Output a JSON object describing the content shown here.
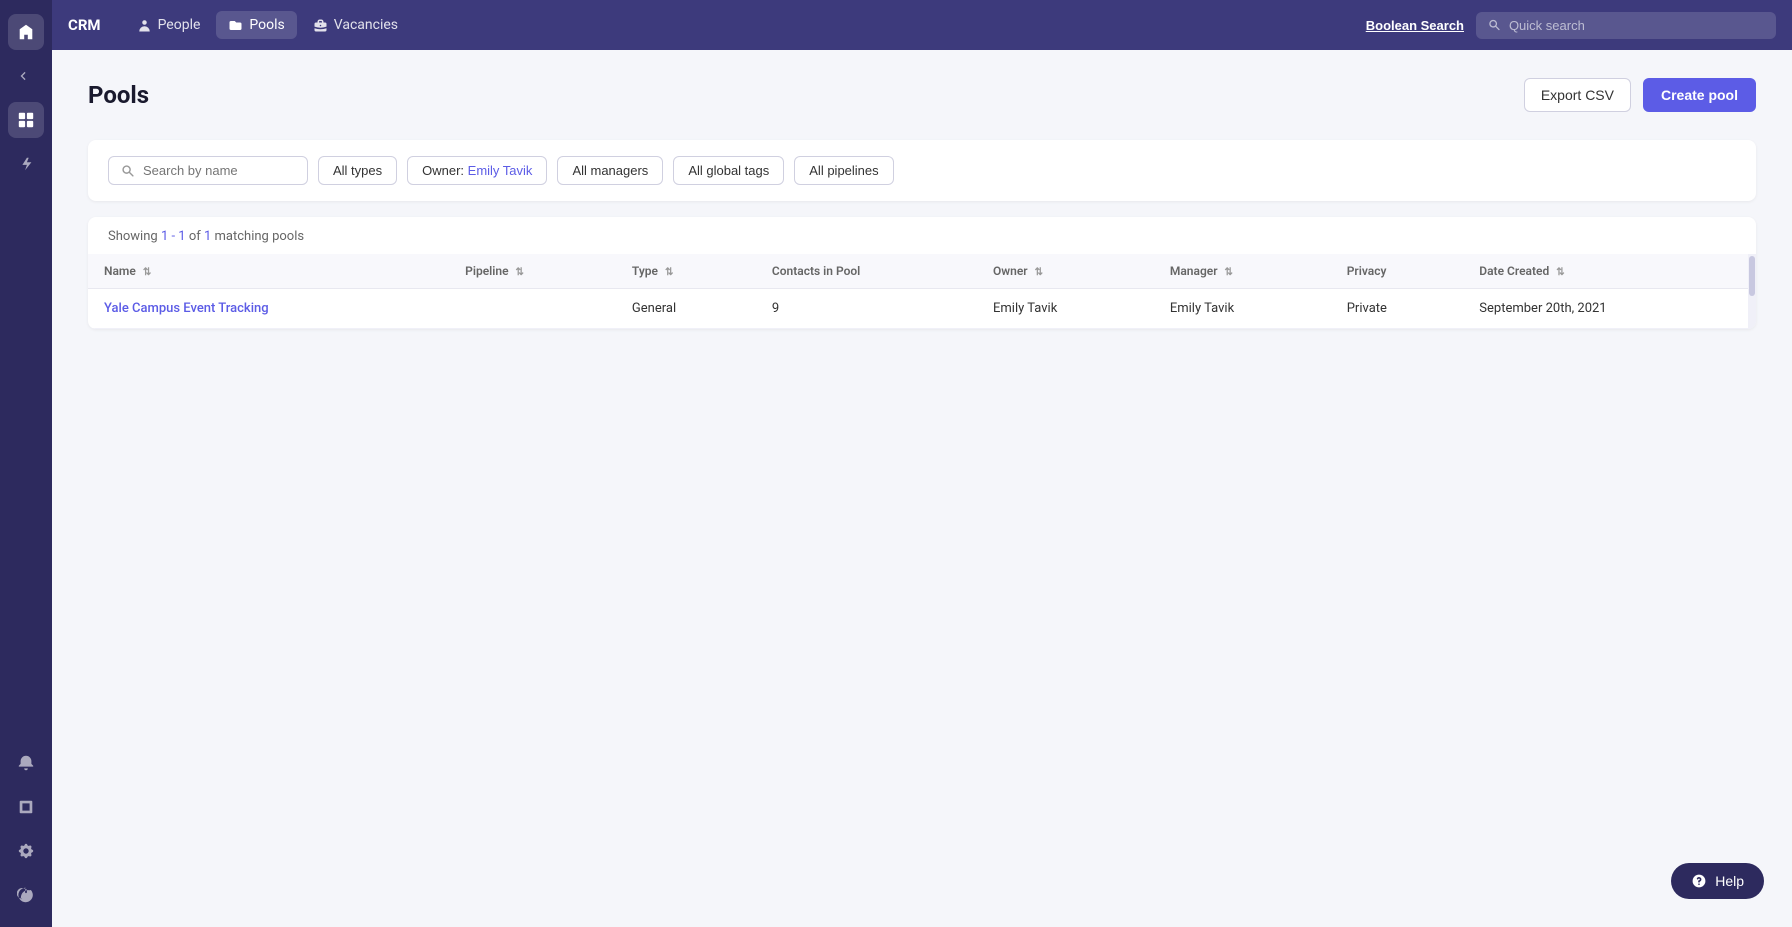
{
  "brand": "CRM",
  "topnav": {
    "items": [
      {
        "id": "people",
        "label": "People",
        "icon": "person"
      },
      {
        "id": "pools",
        "label": "Pools",
        "icon": "folder",
        "active": true
      },
      {
        "id": "vacancies",
        "label": "Vacancies",
        "icon": "briefcase"
      }
    ],
    "boolean_search_label": "Boolean Search",
    "quick_search_placeholder": "Quick search"
  },
  "page": {
    "title": "Pools",
    "export_label": "Export CSV",
    "create_label": "Create pool"
  },
  "filters": {
    "search_placeholder": "Search by name",
    "all_types_label": "All types",
    "owner_label": "Owner: Emily Tavik",
    "all_managers_label": "All managers",
    "all_global_tags_label": "All global tags",
    "all_pipelines_label": "All pipelines"
  },
  "results": {
    "summary": "Showing 1 - 1 of 1 matching pools"
  },
  "table": {
    "columns": [
      {
        "id": "name",
        "label": "Name"
      },
      {
        "id": "pipeline",
        "label": "Pipeline"
      },
      {
        "id": "type",
        "label": "Type"
      },
      {
        "id": "contacts",
        "label": "Contacts in Pool"
      },
      {
        "id": "owner",
        "label": "Owner"
      },
      {
        "id": "manager",
        "label": "Manager"
      },
      {
        "id": "privacy",
        "label": "Privacy"
      },
      {
        "id": "date_created",
        "label": "Date Created"
      }
    ],
    "rows": [
      {
        "name": "Yale Campus Event Tracking",
        "pipeline": "",
        "type": "General",
        "contacts": "9",
        "owner": "Emily Tavik",
        "manager": "Emily Tavik",
        "privacy": "Private",
        "date_created": "September 20th, 2021"
      }
    ]
  },
  "help": {
    "label": "Help"
  },
  "sidebar": {
    "items": [
      {
        "id": "logo",
        "icon": "bolt"
      },
      {
        "id": "back",
        "icon": "back"
      },
      {
        "id": "chart",
        "icon": "chart",
        "active": true
      },
      {
        "id": "lightning",
        "icon": "lightning"
      },
      {
        "id": "bell",
        "icon": "bell"
      },
      {
        "id": "book",
        "icon": "book"
      },
      {
        "id": "settings",
        "icon": "settings"
      },
      {
        "id": "power",
        "icon": "power"
      }
    ]
  }
}
